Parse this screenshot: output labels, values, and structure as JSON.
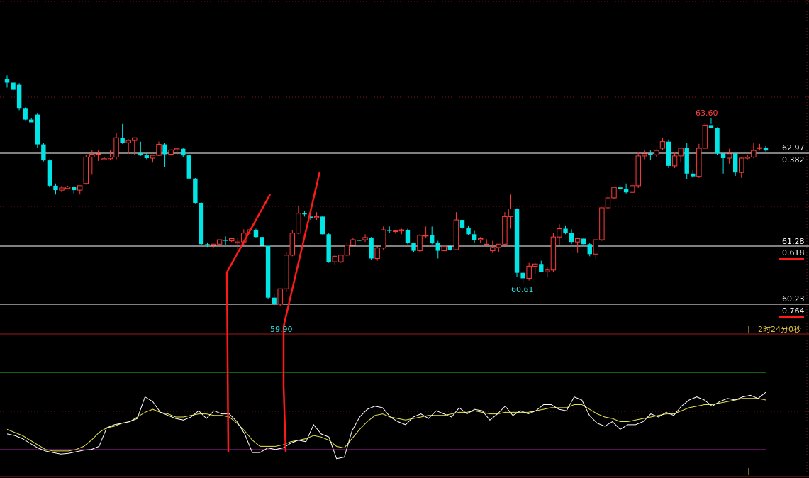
{
  "chart_data": {
    "type": "candlestick",
    "title": "",
    "price_ylim": [
      59.6,
      64.4
    ],
    "fib_levels": [
      {
        "price": "62.97",
        "ratio": "0.382"
      },
      {
        "price": "61.28",
        "ratio": "0.618"
      },
      {
        "price": "60.23",
        "ratio": "0.764"
      }
    ],
    "annotations": {
      "high": "63.60",
      "low1": "59.90",
      "low2": "60.61",
      "countdown": "2时24分0秒"
    },
    "colors": {
      "up": "#ff3c3c",
      "down": "#00e5e5",
      "fib_line": "#ffffff",
      "grid": "#7a1a1a",
      "indicator_fast": "#ffffff",
      "indicator_slow": "#e6e64a",
      "indicator_upper": "#1fbf1f",
      "indicator_lower": "#b41fb4",
      "trendline": "#ff1a1a",
      "high_label": "#ff4040",
      "low_label": "#33dddd",
      "countdown": "#e6c84a"
    },
    "candles": [
      [
        64.31,
        64.38,
        64.16,
        64.25
      ],
      [
        64.25,
        64.25,
        64.08,
        64.12
      ],
      [
        64.21,
        64.24,
        63.75,
        63.79
      ],
      [
        63.79,
        63.8,
        63.57,
        63.58
      ],
      [
        63.58,
        63.6,
        63.54,
        63.53
      ],
      [
        63.67,
        63.7,
        63.07,
        63.13
      ],
      [
        63.13,
        63.15,
        62.82,
        62.84
      ],
      [
        62.84,
        62.86,
        62.35,
        62.38
      ],
      [
        62.38,
        62.42,
        62.22,
        62.3
      ],
      [
        62.3,
        62.38,
        62.26,
        62.34
      ],
      [
        62.33,
        62.38,
        62.32,
        62.36
      ],
      [
        62.36,
        62.37,
        62.24,
        62.3
      ],
      [
        62.3,
        62.33,
        62.22,
        62.38
      ],
      [
        62.42,
        62.94,
        62.4,
        62.9
      ],
      [
        62.9,
        63.02,
        62.58,
        62.95
      ],
      [
        62.95,
        63.02,
        62.83,
        62.96
      ],
      [
        62.85,
        62.9,
        62.85,
        62.87
      ],
      [
        62.87,
        63.02,
        62.84,
        62.9
      ],
      [
        62.9,
        63.34,
        62.86,
        63.25
      ],
      [
        63.25,
        63.5,
        63.14,
        63.16
      ],
      [
        63.16,
        63.22,
        62.96,
        63.2
      ],
      [
        63.2,
        63.24,
        62.94,
        63.25
      ],
      [
        62.97,
        63.18,
        62.92,
        62.93
      ],
      [
        62.93,
        62.96,
        62.86,
        62.88
      ],
      [
        62.88,
        62.94,
        62.8,
        62.93
      ],
      [
        62.93,
        63.18,
        62.92,
        63.13
      ],
      [
        63.13,
        63.15,
        62.72,
        62.95
      ],
      [
        62.95,
        63.04,
        62.93,
        63.03
      ],
      [
        63.03,
        63.07,
        62.92,
        63.05
      ],
      [
        63.05,
        63.07,
        62.9,
        62.93
      ],
      [
        62.93,
        62.95,
        62.5,
        62.51
      ],
      [
        62.51,
        62.52,
        62.06,
        62.07
      ],
      [
        62.07,
        62.08,
        61.3,
        61.32
      ],
      [
        61.32,
        61.35,
        61.27,
        61.3
      ],
      [
        61.3,
        61.33,
        61.26,
        61.32
      ],
      [
        61.32,
        61.38,
        61.3,
        61.4
      ],
      [
        61.4,
        61.46,
        61.3,
        61.38
      ],
      [
        61.38,
        61.44,
        61.36,
        61.42
      ],
      [
        61.34,
        61.44,
        61.12,
        61.36
      ],
      [
        61.36,
        61.59,
        61.3,
        61.52
      ],
      [
        61.52,
        61.66,
        61.5,
        61.58
      ],
      [
        61.58,
        61.6,
        61.44,
        61.45
      ],
      [
        61.45,
        61.48,
        61.28,
        61.29
      ],
      [
        61.29,
        61.29,
        60.33,
        60.35
      ],
      [
        60.35,
        60.42,
        60.2,
        60.23
      ],
      [
        60.23,
        60.28,
        60.19,
        60.51
      ],
      [
        60.51,
        61.18,
        60.45,
        61.12
      ],
      [
        61.12,
        61.58,
        61.1,
        61.52
      ],
      [
        61.52,
        62.02,
        61.5,
        61.88
      ],
      [
        61.88,
        61.92,
        61.82,
        61.86
      ],
      [
        61.82,
        61.86,
        61.76,
        61.8
      ],
      [
        61.8,
        61.9,
        61.76,
        61.82
      ],
      [
        61.82,
        61.83,
        61.48,
        61.5
      ],
      [
        61.5,
        61.52,
        60.98,
        61.0
      ],
      [
        61.0,
        61.12,
        60.94,
        61.1
      ],
      [
        61.0,
        61.1,
        60.98,
        61.12
      ],
      [
        61.12,
        61.36,
        61.08,
        61.3
      ],
      [
        61.3,
        61.44,
        61.3,
        61.4
      ],
      [
        61.4,
        61.42,
        61.34,
        61.38
      ],
      [
        61.4,
        61.5,
        61.36,
        61.44
      ],
      [
        61.44,
        61.45,
        61.04,
        61.06
      ],
      [
        61.06,
        61.28,
        61.02,
        61.25
      ],
      [
        61.25,
        61.64,
        61.22,
        61.58
      ],
      [
        61.58,
        61.64,
        61.52,
        61.56
      ],
      [
        61.56,
        61.58,
        61.51,
        61.56
      ],
      [
        61.56,
        61.6,
        61.5,
        61.58
      ],
      [
        61.58,
        61.6,
        61.32,
        61.34
      ],
      [
        61.34,
        61.35,
        61.18,
        61.2
      ],
      [
        61.2,
        61.5,
        61.18,
        61.48
      ],
      [
        61.48,
        61.64,
        61.44,
        61.48
      ],
      [
        61.48,
        61.64,
        61.32,
        61.34
      ],
      [
        61.34,
        61.38,
        61.06,
        61.2
      ],
      [
        61.2,
        61.24,
        61.2,
        61.28
      ],
      [
        61.28,
        61.3,
        61.2,
        61.22
      ],
      [
        61.22,
        61.9,
        61.26,
        61.76
      ],
      [
        61.76,
        61.76,
        61.6,
        61.62
      ],
      [
        61.62,
        61.66,
        61.48,
        61.5
      ],
      [
        61.5,
        61.56,
        61.34,
        61.4
      ],
      [
        61.4,
        61.45,
        61.34,
        61.42
      ],
      [
        61.32,
        61.41,
        61.3,
        61.32
      ],
      [
        61.2,
        61.38,
        61.16,
        61.26
      ],
      [
        61.26,
        61.32,
        61.18,
        61.32
      ],
      [
        61.32,
        61.9,
        61.3,
        61.82
      ],
      [
        61.82,
        62.22,
        61.6,
        61.96
      ],
      [
        61.96,
        61.97,
        60.72,
        60.8
      ],
      [
        60.8,
        60.83,
        60.6,
        60.7
      ],
      [
        60.7,
        60.98,
        60.66,
        60.92
      ],
      [
        60.92,
        60.98,
        60.78,
        60.96
      ],
      [
        60.96,
        61.02,
        60.84,
        60.82
      ],
      [
        60.82,
        60.9,
        60.72,
        60.85
      ],
      [
        60.85,
        61.52,
        60.82,
        61.45
      ],
      [
        61.45,
        61.68,
        61.3,
        61.6
      ],
      [
        61.6,
        61.66,
        61.5,
        61.52
      ],
      [
        61.52,
        61.59,
        61.32,
        61.36
      ],
      [
        61.36,
        61.44,
        61.16,
        61.42
      ],
      [
        61.42,
        61.44,
        61.28,
        61.32
      ],
      [
        61.32,
        61.34,
        61.1,
        61.14
      ],
      [
        61.14,
        61.4,
        61.06,
        61.4
      ],
      [
        61.4,
        61.8,
        61.38,
        61.98
      ],
      [
        61.98,
        62.26,
        61.96,
        62.16
      ],
      [
        62.16,
        62.34,
        62.14,
        62.35
      ],
      [
        62.35,
        62.4,
        62.28,
        62.32
      ],
      [
        62.32,
        62.42,
        62.24,
        62.26
      ],
      [
        62.26,
        62.42,
        62.25,
        62.38
      ],
      [
        62.38,
        62.98,
        62.34,
        62.92
      ],
      [
        62.92,
        63.02,
        62.86,
        62.96
      ],
      [
        62.96,
        63.02,
        62.84,
        62.94
      ],
      [
        62.94,
        63.04,
        62.9,
        63.02
      ],
      [
        63.06,
        63.24,
        63.02,
        63.18
      ],
      [
        63.18,
        63.22,
        62.7,
        62.74
      ],
      [
        62.74,
        62.98,
        62.7,
        62.92
      ],
      [
        62.92,
        63.06,
        62.8,
        63.06
      ],
      [
        63.06,
        63.16,
        62.5,
        62.6
      ],
      [
        62.6,
        62.66,
        62.52,
        62.55
      ],
      [
        62.55,
        63.14,
        62.52,
        63.06
      ],
      [
        63.06,
        63.52,
        63.04,
        63.48
      ],
      [
        63.48,
        63.6,
        63.5,
        63.42
      ],
      [
        63.42,
        63.44,
        62.94,
        62.96
      ],
      [
        62.96,
        62.98,
        62.6,
        62.88
      ],
      [
        62.88,
        63.05,
        62.78,
        62.96
      ],
      [
        62.96,
        62.98,
        62.56,
        62.62
      ],
      [
        62.62,
        62.9,
        62.52,
        62.88
      ],
      [
        62.88,
        62.94,
        62.86,
        62.9
      ],
      [
        62.9,
        63.16,
        62.88,
        63.02
      ],
      [
        63.06,
        63.14,
        63.02,
        63.07
      ],
      [
        63.07,
        63.1,
        63.0,
        63.02
      ]
    ],
    "indicator_fast": [
      0.66,
      0.68,
      0.72,
      0.78,
      0.84,
      0.88,
      0.9,
      0.92,
      0.91,
      0.89,
      0.87,
      0.86,
      0.82,
      0.58,
      0.54,
      0.52,
      0.5,
      0.46,
      0.18,
      0.24,
      0.38,
      0.42,
      0.46,
      0.48,
      0.44,
      0.36,
      0.46,
      0.36,
      0.4,
      0.4,
      0.5,
      0.66,
      0.9,
      0.9,
      0.84,
      0.86,
      0.84,
      0.78,
      0.74,
      0.76,
      0.54,
      0.66,
      0.7,
      0.98,
      0.96,
      0.62,
      0.44,
      0.34,
      0.3,
      0.32,
      0.44,
      0.5,
      0.54,
      0.44,
      0.4,
      0.46,
      0.36,
      0.4,
      0.44,
      0.32,
      0.4,
      0.34,
      0.36,
      0.48,
      0.4,
      0.3,
      0.42,
      0.36,
      0.4,
      0.36,
      0.28,
      0.28,
      0.34,
      0.36,
      0.18,
      0.22,
      0.42,
      0.52,
      0.56,
      0.5,
      0.6,
      0.54,
      0.54,
      0.5,
      0.4,
      0.44,
      0.38,
      0.42,
      0.3,
      0.22,
      0.18,
      0.22,
      0.3,
      0.24,
      0.2,
      0.22,
      0.18,
      0.16,
      0.2,
      0.12
    ],
    "indicator_slow": [
      0.6,
      0.64,
      0.68,
      0.74,
      0.8,
      0.86,
      0.88,
      0.88,
      0.88,
      0.86,
      0.82,
      0.74,
      0.64,
      0.58,
      0.56,
      0.52,
      0.5,
      0.44,
      0.38,
      0.34,
      0.38,
      0.4,
      0.44,
      0.44,
      0.42,
      0.4,
      0.4,
      0.42,
      0.42,
      0.44,
      0.52,
      0.62,
      0.74,
      0.82,
      0.82,
      0.82,
      0.8,
      0.76,
      0.74,
      0.72,
      0.68,
      0.7,
      0.74,
      0.82,
      0.84,
      0.72,
      0.6,
      0.5,
      0.42,
      0.4,
      0.44,
      0.46,
      0.48,
      0.46,
      0.44,
      0.42,
      0.42,
      0.42,
      0.4,
      0.38,
      0.38,
      0.36,
      0.38,
      0.4,
      0.4,
      0.38,
      0.38,
      0.38,
      0.38,
      0.36,
      0.34,
      0.32,
      0.32,
      0.32,
      0.28,
      0.28,
      0.34,
      0.4,
      0.44,
      0.46,
      0.5,
      0.5,
      0.48,
      0.46,
      0.44,
      0.42,
      0.4,
      0.4,
      0.36,
      0.32,
      0.3,
      0.28,
      0.28,
      0.26,
      0.24,
      0.22,
      0.2,
      0.2,
      0.2,
      0.22
    ]
  }
}
